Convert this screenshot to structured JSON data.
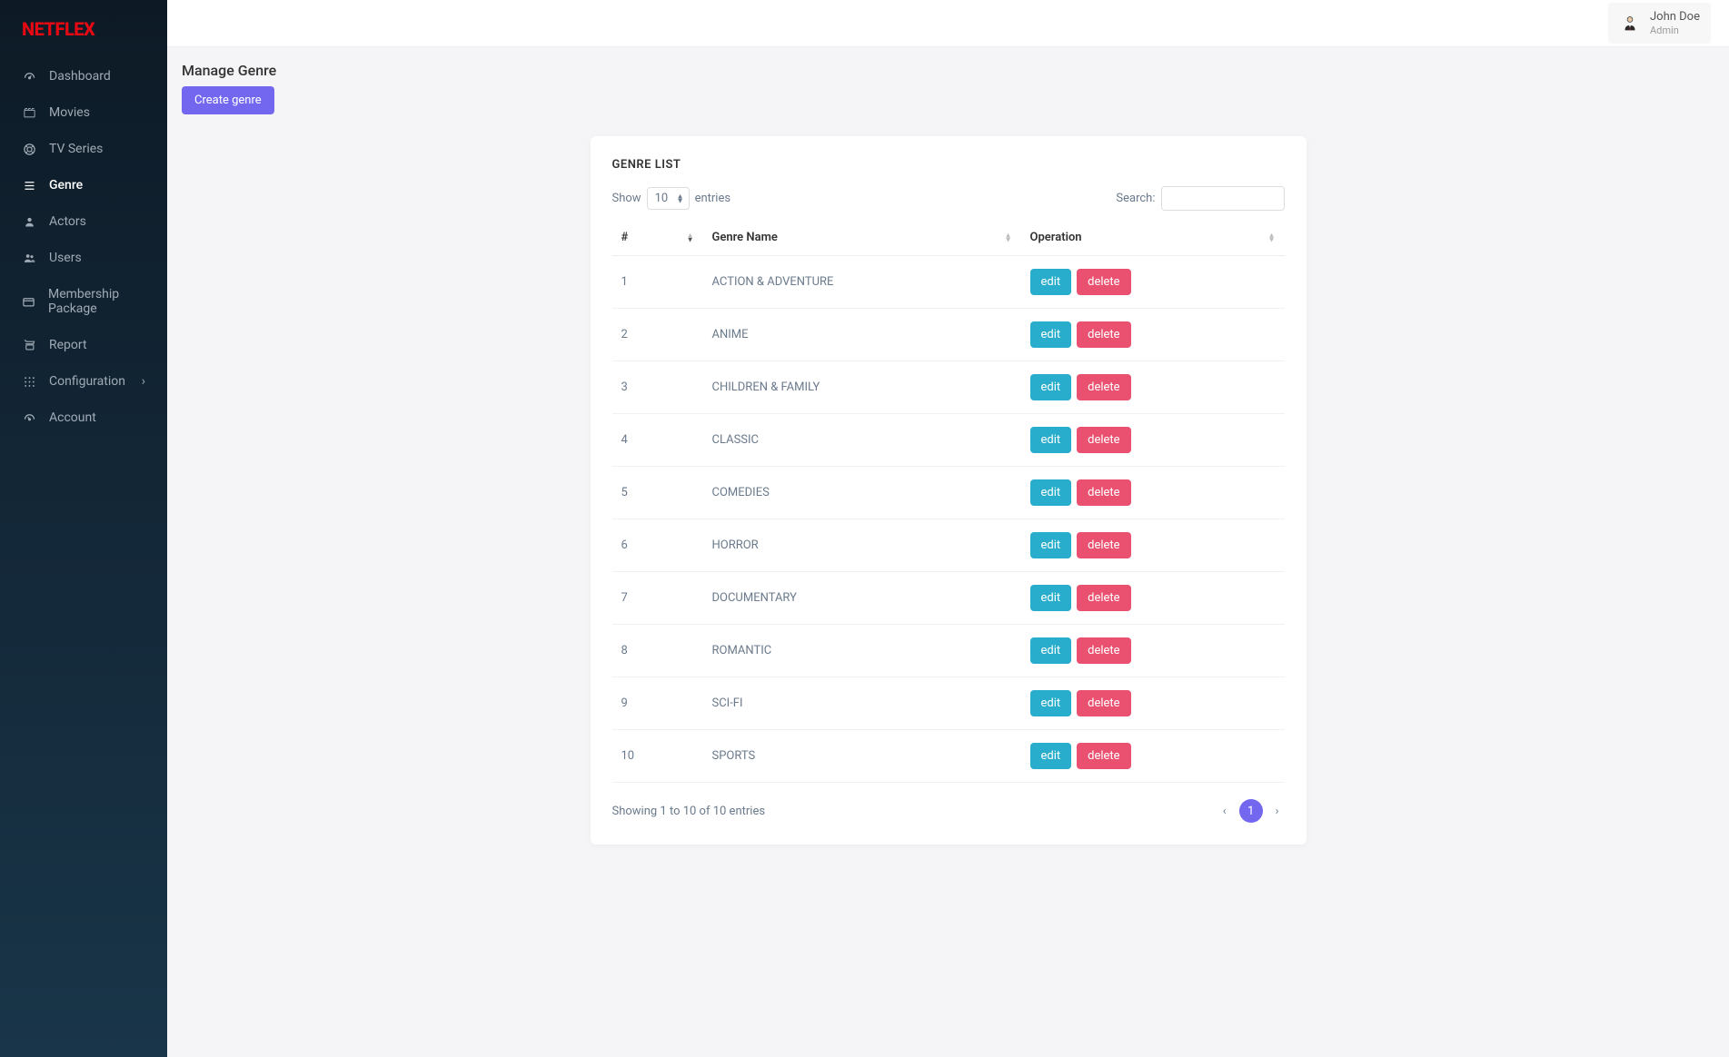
{
  "brand": "NETFLEX",
  "sidebar": {
    "items": [
      {
        "label": "Dashboard",
        "icon": "dashboard"
      },
      {
        "label": "Movies",
        "icon": "movies"
      },
      {
        "label": "TV Series",
        "icon": "tvseries"
      },
      {
        "label": "Genre",
        "icon": "genre",
        "active": true
      },
      {
        "label": "Actors",
        "icon": "actors"
      },
      {
        "label": "Users",
        "icon": "users"
      },
      {
        "label": "Membership Package",
        "icon": "membership"
      },
      {
        "label": "Report",
        "icon": "report"
      },
      {
        "label": "Configuration",
        "icon": "configuration",
        "hasChildren": true
      },
      {
        "label": "Account",
        "icon": "account"
      }
    ]
  },
  "header": {
    "user_name": "John Doe",
    "user_role": "Admin"
  },
  "page": {
    "title": "Manage Genre",
    "create_button": "Create genre"
  },
  "card": {
    "title": "GENRE LIST",
    "show_label": "Show",
    "entries_label": "entries",
    "length_value": "10",
    "search_label": "Search:",
    "columns": [
      "#",
      "Genre Name",
      "Operation"
    ],
    "rows": [
      {
        "n": "1",
        "name": "ACTION & ADVENTURE"
      },
      {
        "n": "2",
        "name": "ANIME"
      },
      {
        "n": "3",
        "name": "CHILDREN & FAMILY"
      },
      {
        "n": "4",
        "name": "CLASSIC"
      },
      {
        "n": "5",
        "name": "COMEDIES"
      },
      {
        "n": "6",
        "name": "HORROR"
      },
      {
        "n": "7",
        "name": "DOCUMENTARY"
      },
      {
        "n": "8",
        "name": "ROMANTIC"
      },
      {
        "n": "9",
        "name": "SCI-FI"
      },
      {
        "n": "10",
        "name": "SPORTS"
      }
    ],
    "edit_label": "edit",
    "delete_label": "delete",
    "footer_info": "Showing 1 to 10 of 10 entries",
    "page_number": "1"
  }
}
